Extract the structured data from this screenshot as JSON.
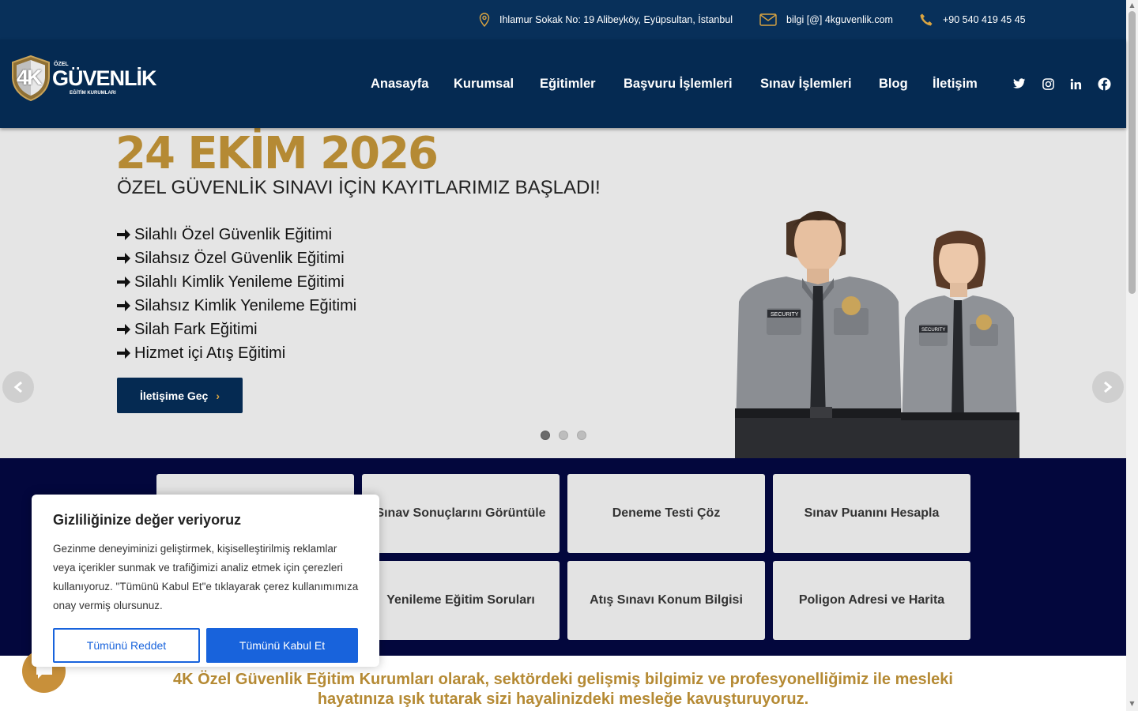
{
  "topbar": {
    "address": "Ihlamur Sokak No: 19 Alibeyköy, Eyüpsultan, İstanbul",
    "email": "bilgi [@] 4kguvenlik.com",
    "phone": "+90 540 419 45 45"
  },
  "logo": {
    "prefix": "ÖZEL",
    "main": "GÜVENLİK",
    "sub": "EĞİTİM KURUMLARI",
    "badge": "4K"
  },
  "nav": {
    "items": [
      "Anasayfa",
      "Kurumsal",
      "Eğitimler",
      "Başvuru İşlemleri",
      "Sınav İşlemleri",
      "Blog",
      "İletişim"
    ]
  },
  "social": [
    "twitter-icon",
    "instagram-icon",
    "linkedin-icon",
    "facebook-icon"
  ],
  "hero": {
    "date": "24 EKİM 2026",
    "subtitle": "ÖZEL GÜVENLİK SINAVI İÇİN KAYITLARIMIZ BAŞLADI!",
    "list": [
      "Silahlı Özel Güvenlik Eğitimi",
      "Silahsız Özel Güvenlik Eğitimi",
      "Silahlı Kimlik Yenileme Eğitimi",
      "Silahsız Kimlik Yenileme Eğitimi",
      "Silah Fark Eğitimi",
      "Hizmet içi Atış Eğitimi"
    ],
    "cta": "İletişime Geç",
    "slide_count": 3,
    "active_slide": 1
  },
  "tiles": [
    "",
    "Sınav Sonuçlarını Görüntüle",
    "Deneme Testi Çöz",
    "Sınav Puanını Hesapla",
    "",
    "Yenileme Eğitim Soruları",
    "Atış Sınavı Konum Bilgisi",
    "Poligon Adresi ve Harita"
  ],
  "mission": {
    "line1": "4K Özel Güvenlik Eğitim Kurumları olarak, sektördeki gelişmiş bilgimiz ve profesyonelliğimiz ile mesleki",
    "line2": "hayatınıza ışık tutarak sizi hayalinizdeki mesleğe kavuşturuyoruz."
  },
  "cookie": {
    "title": "Gizliliğinize değer veriyoruz",
    "body": "Gezinme deneyiminizi geliştirmek, kişiselleştirilmiş reklamlar veya içerikler sunmak ve trafiğimizi analiz etmek için çerezleri kullanıyoruz. \"Tümünü Kabul Et\"e tıklayarak çerez kullanımımıza onay vermiş olursunuz.",
    "reject": "Tümünü Reddet",
    "accept": "Tümünü Kabul Et"
  },
  "colors": {
    "topbar": "#08305a",
    "header": "#052a52",
    "gold": "#b58a34",
    "tiles_bg": "#03073d",
    "cookie_blue": "#1863dc"
  }
}
